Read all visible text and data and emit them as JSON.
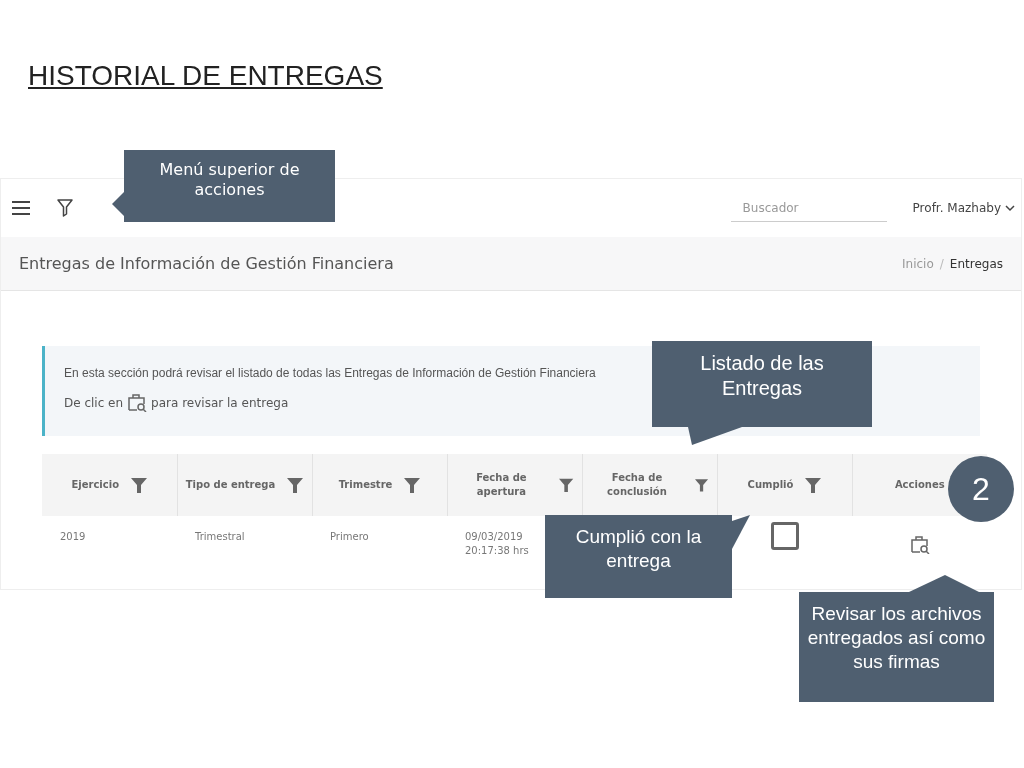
{
  "slide_title": "HISTORIAL DE ENTREGAS",
  "topbar": {
    "search": {
      "placeholder": "Buscador"
    },
    "user": "Profr. Mazhaby"
  },
  "page_header": {
    "title": "Entregas de Información de Gestión Financiera",
    "separator": "/",
    "breadcrumb": [
      {
        "label": "Inicio",
        "selected": false
      },
      {
        "label": "Entregas",
        "selected": true
      }
    ]
  },
  "info": {
    "line_1": "En esta sección podrá revisar el listado de todas las Entregas de Información de Gestión Financiera",
    "line_2_before": "De clic en",
    "line_2_after": "para revisar la entrega"
  },
  "table": {
    "columns": [
      {
        "label": "Ejercicio",
        "filter": true
      },
      {
        "label": "Tipo de entrega",
        "filter": true
      },
      {
        "label": "Trimestre",
        "filter": true
      },
      {
        "label": "Fecha de apertura",
        "filter": true
      },
      {
        "label": "Fecha de conclusión",
        "filter": true
      },
      {
        "label": "Cumplió",
        "filter": true
      },
      {
        "label": "Acciones",
        "filter": false
      }
    ],
    "rows": [
      {
        "cells": [
          "2019",
          "Trimestral",
          "Primero",
          "09/03/2019 20:17:38 hrs"
        ],
        "checked": false
      }
    ]
  },
  "callouts": [
    {
      "text": "Menú superior de acciones"
    },
    {
      "text": "Listado de las Entregas"
    },
    {
      "text": "Cumplió con la entrega"
    },
    {
      "text": "Revisar los archivos entregados así como sus firmas"
    }
  ],
  "step_badge": "2"
}
